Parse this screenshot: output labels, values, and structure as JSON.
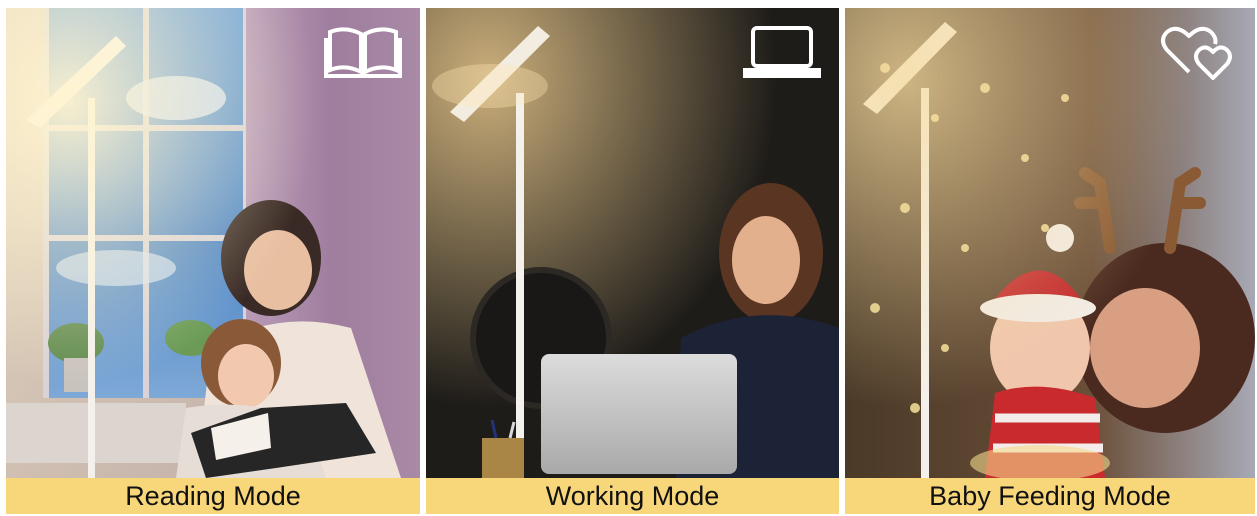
{
  "colors": {
    "caption_bg": "#F8D77A",
    "caption_text": "#111111",
    "icon": "#ffffff"
  },
  "panels": [
    {
      "caption": "Reading Mode",
      "icon": "open-book-icon"
    },
    {
      "caption": "Working Mode",
      "icon": "laptop-icon"
    },
    {
      "caption": "Baby Feeding Mode",
      "icon": "two-hearts-icon"
    }
  ]
}
